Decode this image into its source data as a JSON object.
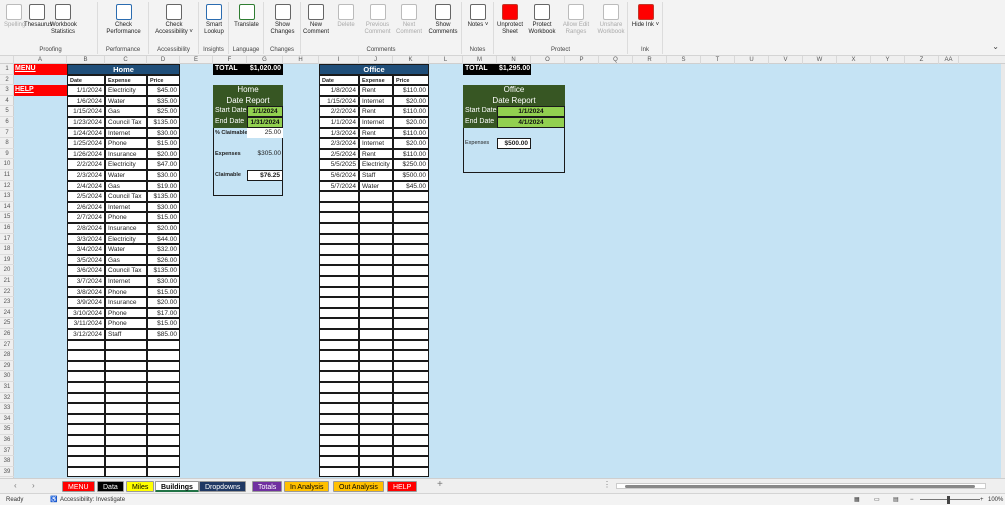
{
  "ribbon": {
    "groups": [
      {
        "label": "Proofing",
        "buttons": [
          {
            "label": "Spelling",
            "dis": true
          },
          {
            "label": "Thesaurus"
          },
          {
            "label": "Workbook Statistics"
          }
        ]
      },
      {
        "label": "Performance",
        "buttons": [
          {
            "label": "Check Performance"
          }
        ]
      },
      {
        "label": "Accessibility",
        "buttons": [
          {
            "label": "Check Accessibility ˅"
          }
        ]
      },
      {
        "label": "Insights",
        "buttons": [
          {
            "label": "Smart Lookup"
          }
        ]
      },
      {
        "label": "Language",
        "buttons": [
          {
            "label": "Translate"
          }
        ]
      },
      {
        "label": "Changes",
        "buttons": [
          {
            "label": "Show Changes"
          }
        ]
      },
      {
        "label": "Comments",
        "buttons": [
          {
            "label": "New Comment"
          },
          {
            "label": "Delete",
            "dis": true
          },
          {
            "label": "Previous Comment",
            "dis": true
          },
          {
            "label": "Next Comment",
            "dis": true
          },
          {
            "label": "Show Comments"
          }
        ]
      },
      {
        "label": "Notes",
        "buttons": [
          {
            "label": "Notes ˅"
          }
        ]
      },
      {
        "label": "Protect",
        "buttons": [
          {
            "label": "Unprotect Sheet"
          },
          {
            "label": "Protect Workbook"
          },
          {
            "label": "Allow Edit Ranges",
            "dis": true
          },
          {
            "label": "Unshare Workbook",
            "dis": true
          }
        ]
      },
      {
        "label": "Ink",
        "buttons": [
          {
            "label": "Hide Ink ˅"
          }
        ]
      }
    ],
    "collapse_glyph": "⌄"
  },
  "columns": [
    "A",
    "B",
    "C",
    "D",
    "E",
    "F",
    "G",
    "H",
    "I",
    "J",
    "K",
    "L",
    "M",
    "N",
    "O",
    "P",
    "Q",
    "R",
    "S",
    "T",
    "U",
    "V",
    "W",
    "X",
    "Y",
    "Z",
    "AA"
  ],
  "menu": {
    "menu_label": "MENU",
    "help_label": "HELP"
  },
  "home": {
    "title": "Home",
    "col_headers": [
      "Date",
      "Expense",
      "Price"
    ],
    "rows": [
      [
        "1/1/2024",
        "Electricity",
        "$45.00"
      ],
      [
        "1/6/2024",
        "Water",
        "$35.00"
      ],
      [
        "1/15/2024",
        "Gas",
        "$25.00"
      ],
      [
        "1/23/2024",
        "Council Tax",
        "$135.00"
      ],
      [
        "1/24/2024",
        "Internet",
        "$30.00"
      ],
      [
        "1/25/2024",
        "Phone",
        "$15.00"
      ],
      [
        "1/26/2024",
        "Insurance",
        "$20.00"
      ],
      [
        "2/2/2024",
        "Electricity",
        "$47.00"
      ],
      [
        "2/3/2024",
        "Water",
        "$30.00"
      ],
      [
        "2/4/2024",
        "Gas",
        "$19.00"
      ],
      [
        "2/5/2024",
        "Council Tax",
        "$135.00"
      ],
      [
        "2/6/2024",
        "Internet",
        "$30.00"
      ],
      [
        "2/7/2024",
        "Phone",
        "$15.00"
      ],
      [
        "2/8/2024",
        "Insurance",
        "$20.00"
      ],
      [
        "3/3/2024",
        "Electricity",
        "$44.00"
      ],
      [
        "3/4/2024",
        "Water",
        "$32.00"
      ],
      [
        "3/5/2024",
        "Gas",
        "$26.00"
      ],
      [
        "3/6/2024",
        "Council Tax",
        "$135.00"
      ],
      [
        "3/7/2024",
        "Internet",
        "$30.00"
      ],
      [
        "3/8/2024",
        "Phone",
        "$15.00"
      ],
      [
        "3/9/2024",
        "Insurance",
        "$20.00"
      ],
      [
        "3/10/2024",
        "Phone",
        "$17.00"
      ],
      [
        "3/11/2024",
        "Phone",
        "$15.00"
      ],
      [
        "3/12/2024",
        "Staff",
        "$85.00"
      ]
    ]
  },
  "home_total": {
    "label": "TOTAL",
    "value": "$1,020.00"
  },
  "home_report": {
    "title": "Home",
    "subtitle": "Date Report",
    "start_label": "Start Date",
    "start_value": "1/1/2024",
    "end_label": "End Date",
    "end_value": "1/31/2024",
    "pct_label": "% Claimable",
    "pct_value": "25.00",
    "expenses_label": "Expenses",
    "expenses_value": "$305.00",
    "claimable_label": "Claimable",
    "claimable_value": "$76.25"
  },
  "office": {
    "title": "Office",
    "col_headers": [
      "Date",
      "Expense",
      "Price"
    ],
    "rows": [
      [
        "1/8/2024",
        "Rent",
        "$110.00"
      ],
      [
        "1/15/2024",
        "Internet",
        "$20.00"
      ],
      [
        "2/2/2024",
        "Rent",
        "$110.00"
      ],
      [
        "1/1/2024",
        "Internet",
        "$20.00"
      ],
      [
        "1/3/2024",
        "Rent",
        "$110.00"
      ],
      [
        "2/3/2024",
        "Internet",
        "$20.00"
      ],
      [
        "2/5/2024",
        "Rent",
        "$110.00"
      ],
      [
        "5/5/2025",
        "Electricity",
        "$250.00"
      ],
      [
        "5/6/2024",
        "Staff",
        "$500.00"
      ],
      [
        "5/7/2024",
        "Water",
        "$45.00"
      ]
    ]
  },
  "office_total": {
    "label": "TOTAL",
    "value": "$1,295.00"
  },
  "office_report": {
    "title": "Office",
    "subtitle": "Date Report",
    "start_label": "Start Date",
    "start_value": "1/1/2024",
    "end_label": "End Date",
    "end_value": "4/1/2024",
    "expenses_label": "Expenses",
    "expenses_value": "$500.00"
  },
  "tabs": [
    {
      "label": "MENU",
      "bg": "#ff0000",
      "fg": "#ffffff"
    },
    {
      "label": "Data",
      "bg": "#000000",
      "fg": "#ffffff"
    },
    {
      "label": "Miles",
      "bg": "#ffff00",
      "fg": "#000000"
    },
    {
      "label": "Buildings",
      "bg": "#ffffff",
      "fg": "#000000",
      "active": true
    },
    {
      "label": "Dropdowns",
      "bg": "#1f3864",
      "fg": "#ffffff"
    },
    {
      "label": "Totals",
      "bg": "#7030a0",
      "fg": "#ffffff"
    },
    {
      "label": "In Analysis",
      "bg": "#ffc000",
      "fg": "#000000"
    },
    {
      "label": "Out Analysis",
      "bg": "#ffc000",
      "fg": "#000000"
    },
    {
      "label": "HELP",
      "bg": "#ff0000",
      "fg": "#ffffff"
    }
  ],
  "status": {
    "ready": "Ready",
    "accessibility": "Accessibility: Investigate",
    "zoom": "100%"
  }
}
